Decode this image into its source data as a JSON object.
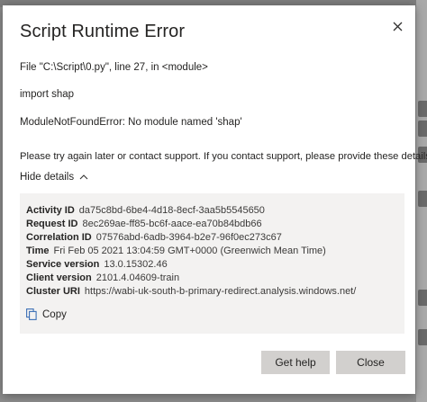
{
  "dialog": {
    "title": "Script Runtime Error",
    "lines": [
      "File \"C:\\Script\\0.py\", line 27, in <module>",
      "import shap",
      "ModuleNotFoundError: No module named 'shap'",
      "Please try again later or contact support. If you contact support, please provide these details."
    ],
    "hide_details_label": "Hide details",
    "details": {
      "activity_id": {
        "key": "Activity ID",
        "value": "da75c8bd-6be4-4d18-8ecf-3aa5b5545650"
      },
      "request_id": {
        "key": "Request ID",
        "value": "8ec269ae-ff85-bc6f-aace-ea70b84bdb66"
      },
      "correlation_id": {
        "key": "Correlation ID",
        "value": "07576abd-6adb-3964-b2e7-96f0ec273c67"
      },
      "time": {
        "key": "Time",
        "value": "Fri Feb 05 2021 13:04:59 GMT+0000 (Greenwich Mean Time)"
      },
      "service_version": {
        "key": "Service version",
        "value": "13.0.15302.46"
      },
      "client_version": {
        "key": "Client version",
        "value": "2101.4.04609-train"
      },
      "cluster_uri": {
        "key": "Cluster URI",
        "value": "https://wabi-uk-south-b-primary-redirect.analysis.windows.net/"
      }
    },
    "copy_label": "Copy",
    "buttons": {
      "help": "Get help",
      "close": "Close"
    }
  },
  "icons": {
    "close": "close-icon",
    "chevron": "chevron-up-icon",
    "copy": "copy-icon"
  },
  "colors": {
    "background_overlay": "#8c8c8c",
    "dialog": "#ffffff",
    "details_panel": "#f3f2f1",
    "button": "#d2d0ce"
  }
}
